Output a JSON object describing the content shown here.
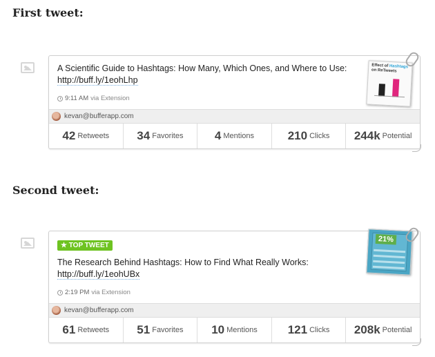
{
  "sections": [
    {
      "heading": "First tweet:",
      "badge": "",
      "tweet_text": "A Scientific Guide to Hashtags: How Many, Which Ones, and Where to Use:",
      "tweet_link": "http://buff.ly/1eohLhp",
      "time": "9:11 AM",
      "via": "via Extension",
      "account": "kevan@bufferapp.com",
      "thumbnail": {
        "title_pre": "Effect of",
        "title_highlight": "Hashtags",
        "title_post": "on ReTweets"
      },
      "stats": [
        {
          "value": "42",
          "label": "Retweets"
        },
        {
          "value": "34",
          "label": "Favorites"
        },
        {
          "value": "4",
          "label": "Mentions"
        },
        {
          "value": "210",
          "label": "Clicks"
        },
        {
          "value": "244k",
          "label": "Potential"
        }
      ]
    },
    {
      "heading": "Second tweet:",
      "badge": "TOP TWEET",
      "tweet_text": "The Research Behind Hashtags: How to Find What Really Works:",
      "tweet_link": "http://buff.ly/1eohUBx",
      "time": "2:19 PM",
      "via": "via Extension",
      "account": "kevan@bufferapp.com",
      "thumbnail": {
        "number": "21%"
      },
      "stats": [
        {
          "value": "61",
          "label": "Retweets"
        },
        {
          "value": "51",
          "label": "Favorites"
        },
        {
          "value": "10",
          "label": "Mentions"
        },
        {
          "value": "121",
          "label": "Clicks"
        },
        {
          "value": "208k",
          "label": "Potential"
        }
      ]
    }
  ],
  "colors": {
    "badge": "#6ec321",
    "link_underline": "#7ab0e0",
    "border": "#cfcfcf"
  }
}
